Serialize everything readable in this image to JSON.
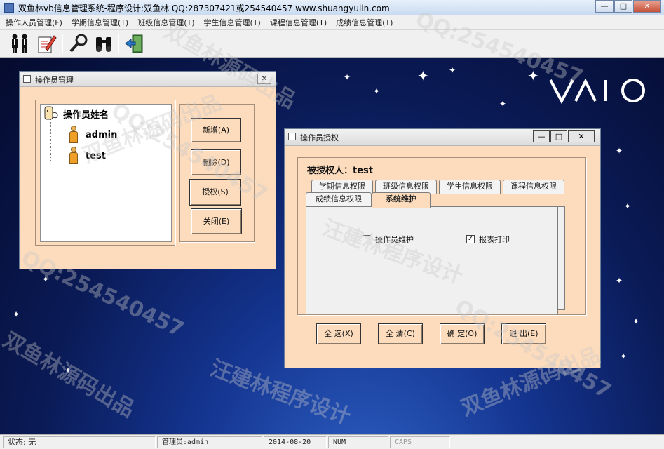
{
  "app": {
    "title": "双鱼林vb信息管理系统-程序设计:双鱼林 QQ:287307421或254540457 www.shuangyulin.com"
  },
  "window_controls": {
    "minimize": "—",
    "maximize": "□",
    "close": "✕"
  },
  "menu": [
    "操作人员管理(F)",
    "学期信息管理(T)",
    "班级信息管理(T)",
    "学生信息管理(T)",
    "课程信息管理(T)",
    "成绩信息管理(T)"
  ],
  "toolbar_icons": [
    "operators-icon",
    "edit-document-icon",
    "search-key-icon",
    "binoculars-icon",
    "exit-door-icon"
  ],
  "operator_window": {
    "title": "操作员管理",
    "tree_root": "操作员姓名",
    "users": [
      "admin",
      "test"
    ],
    "buttons": [
      "新增(A)",
      "删除(D)",
      "授权(S)",
      "关闭(E)"
    ]
  },
  "auth_window": {
    "title": "操作员授权",
    "grantee_label": "被授权人：test",
    "tabs_row1": [
      "学期信息权限",
      "班级信息权限",
      "学生信息权限",
      "课程信息权限"
    ],
    "tabs_row2": [
      "成绩信息权限",
      "系统维护"
    ],
    "active_tab": "系统维护",
    "checkboxes": [
      {
        "label": "操作员维护",
        "checked": false
      },
      {
        "label": "报表打印",
        "checked": true
      }
    ],
    "buttons": [
      "全 选(X)",
      "全 清(C)",
      "确 定(O)",
      "退 出(E)"
    ]
  },
  "desktop": {
    "logo": "VAIO"
  },
  "watermarks": [
    "双鱼林源码出品",
    "QQ:254540457",
    "汪建林程序设计"
  ],
  "statusbar": {
    "status": "状态:  无",
    "admin": "管理员:admin",
    "date": "2014-08-20",
    "num": "NUM",
    "caps": "CAPS"
  }
}
